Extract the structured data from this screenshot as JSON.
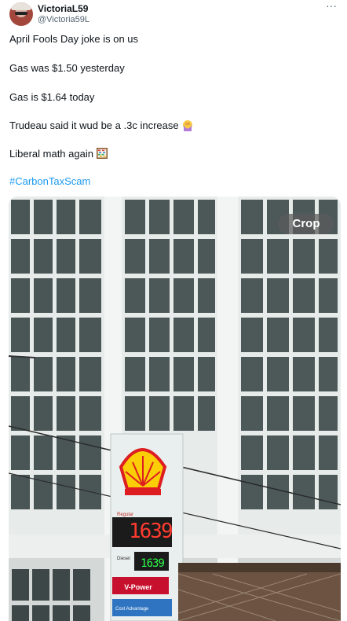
{
  "tweet": {
    "display_name": "VictoriaL59",
    "handle": "@Victoria59L",
    "more_icon": "more-horizontal-icon",
    "lines": [
      "April Fools Day joke is on us",
      "Gas was $1.50 yesterday",
      "Gas is $1.64 today",
      "Trudeau said it wud be a .3c increase",
      "Liberal math again"
    ],
    "hashtag": "#CarbonTaxScam"
  },
  "media": {
    "crop_label": "Crop",
    "sign_price_main": "1639",
    "sign_price_secondary": "1639",
    "sign_vpower": "V-Power"
  },
  "colors": {
    "link": "#1d9bf0",
    "muted": "#536471",
    "shell_red": "#dd1d21",
    "shell_yellow": "#fbce07"
  }
}
